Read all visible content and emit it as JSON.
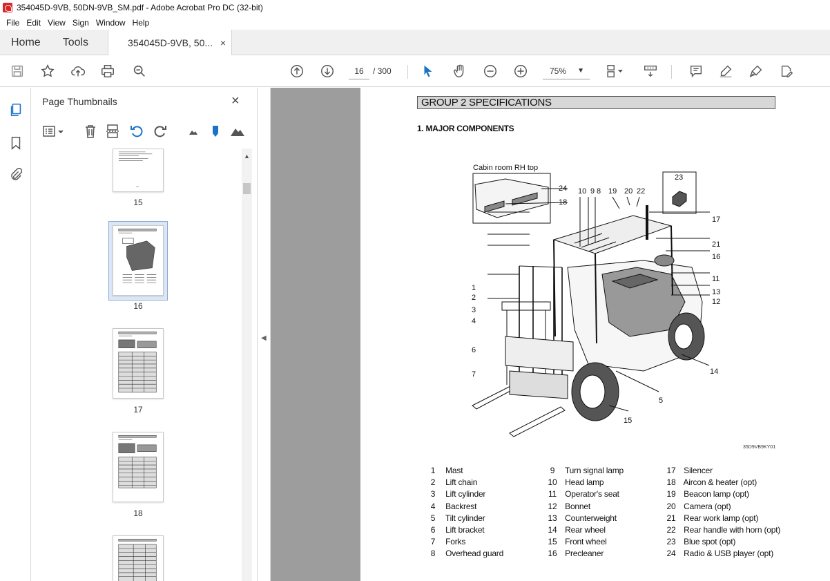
{
  "window": {
    "title": "354045D-9VB, 50DN-9VB_SM.pdf - Adobe Acrobat Pro DC (32-bit)"
  },
  "menu": [
    "File",
    "Edit",
    "View",
    "Sign",
    "Window",
    "Help"
  ],
  "tabs": {
    "home": "Home",
    "tools": "Tools",
    "document": "354045D-9VB, 50...",
    "close": "×"
  },
  "toolbar": {
    "current_page": "16",
    "total_pages": "/ 300",
    "zoom": "75%"
  },
  "panel": {
    "title": "Page Thumbnails",
    "close": "×",
    "thumbnails": [
      {
        "label": "15"
      },
      {
        "label": "16",
        "selected": true
      },
      {
        "label": "17"
      },
      {
        "label": "18"
      }
    ]
  },
  "document": {
    "group_header": "GROUP 2  SPECIFICATIONS",
    "section_header": "1. MAJOR COMPONENTS",
    "figure": {
      "inset_label": "Cabin room RH top",
      "figure_code": "35D9VB9KY01",
      "callouts": [
        "24",
        "18",
        "10",
        "9",
        "8",
        "19",
        "20",
        "22",
        "23",
        "17",
        "21",
        "16",
        "11",
        "13",
        "12",
        "1",
        "2",
        "3",
        "4",
        "6",
        "7",
        "14",
        "5",
        "15"
      ]
    },
    "legend": [
      [
        {
          "n": "1",
          "t": "Mast"
        },
        {
          "n": "2",
          "t": "Lift chain"
        },
        {
          "n": "3",
          "t": "Lift cylinder"
        },
        {
          "n": "4",
          "t": "Backrest"
        },
        {
          "n": "5",
          "t": "Tilt cylinder"
        },
        {
          "n": "6",
          "t": "Lift bracket"
        },
        {
          "n": "7",
          "t": "Forks"
        },
        {
          "n": "8",
          "t": "Overhead guard"
        }
      ],
      [
        {
          "n": "9",
          "t": "Turn signal lamp"
        },
        {
          "n": "10",
          "t": "Head lamp"
        },
        {
          "n": "11",
          "t": "Operator's seat"
        },
        {
          "n": "12",
          "t": "Bonnet"
        },
        {
          "n": "13",
          "t": "Counterweight"
        },
        {
          "n": "14",
          "t": "Rear wheel"
        },
        {
          "n": "15",
          "t": "Front wheel"
        },
        {
          "n": "16",
          "t": "Precleaner"
        }
      ],
      [
        {
          "n": "17",
          "t": "Silencer"
        },
        {
          "n": "18",
          "t": "Aircon & heater (opt)"
        },
        {
          "n": "19",
          "t": "Beacon lamp (opt)"
        },
        {
          "n": "20",
          "t": "Camera (opt)"
        },
        {
          "n": "21",
          "t": "Rear work lamp (opt)"
        },
        {
          "n": "22",
          "t": "Rear handle with horn (opt)"
        },
        {
          "n": "23",
          "t": "Blue spot (opt)"
        },
        {
          "n": "24",
          "t": "Radio & USB player (opt)"
        }
      ]
    ]
  }
}
